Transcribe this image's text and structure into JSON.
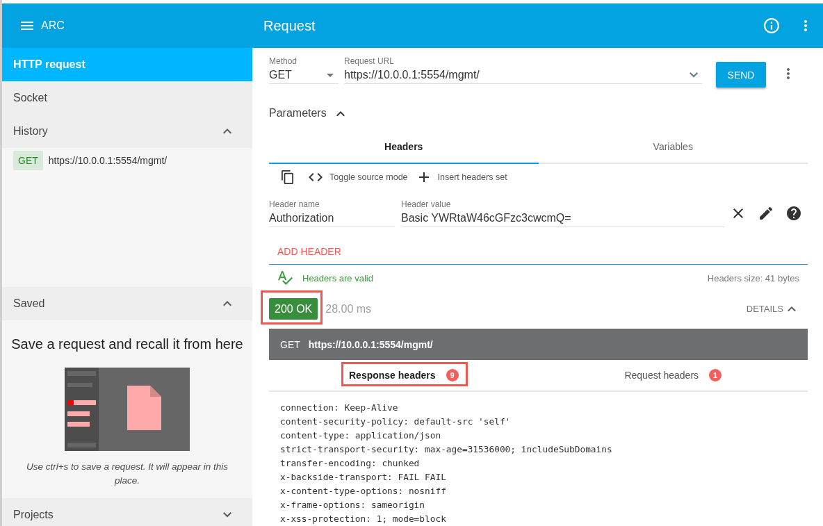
{
  "app_bar": {
    "title": "ARC"
  },
  "sidebar": {
    "items": [
      {
        "label": "HTTP request",
        "selected": true
      },
      {
        "label": "Socket",
        "selected": false
      }
    ],
    "history": {
      "title": "History",
      "expanded": true,
      "entries": [
        {
          "method": "GET",
          "url": "https://10.0.0.1:5554/mgmt/"
        }
      ]
    },
    "saved": {
      "title": "Saved",
      "expanded": true,
      "empty_title": "Save a request and recall it from here",
      "empty_hint": "Use ctrl+s to save a request. It will appear in this place."
    },
    "projects": {
      "title": "Projects",
      "expanded": false
    }
  },
  "toolbar": {
    "title": "Request"
  },
  "request": {
    "method": {
      "label": "Method",
      "value": "GET"
    },
    "url": {
      "label": "Request URL",
      "value": "https://10.0.0.1:5554/mgmt/"
    },
    "send_button": "SEND"
  },
  "parameters": {
    "label": "Parameters",
    "expanded": true,
    "tabs": [
      {
        "label": "Headers",
        "selected": true
      },
      {
        "label": "Variables",
        "selected": false
      }
    ],
    "actions": [
      {
        "kind": "copy"
      },
      {
        "kind": "source",
        "label": "Toggle source mode"
      },
      {
        "kind": "insert",
        "label": "Insert headers set"
      }
    ],
    "headers": [
      {
        "name_label": "Header name",
        "name": "Authorization",
        "value_label": "Header value",
        "value": "Basic YWRtaW46cGFzc3cwcmQ="
      }
    ],
    "add_button": "ADD HEADER",
    "validation": {
      "valid": true,
      "message": "Headers are valid"
    },
    "size": "Headers size: 41 bytes"
  },
  "response": {
    "status": {
      "text": "200 OK",
      "kind": "success",
      "highlighted": true
    },
    "time": "28.00 ms",
    "details_button": "DETAILS",
    "details_expanded": true,
    "request_line": {
      "method": "GET",
      "url": "https://10.0.0.1:5554/mgmt/"
    },
    "tabs": [
      {
        "label": "Response headers",
        "count": "9",
        "selected": true,
        "highlighted": true
      },
      {
        "label": "Request headers",
        "count": "1",
        "selected": false,
        "highlighted": false
      }
    ],
    "headers": [
      "connection: Keep-Alive",
      "content-security-policy: default-src 'self'",
      "content-type: application/json",
      "strict-transport-security: max-age=31536000; includeSubDomains",
      "transfer-encoding: chunked",
      "x-backside-transport: FAIL FAIL",
      "x-content-type-options: nosniff",
      "x-frame-options: sameorigin",
      "x-xss-protection: 1; mode=block"
    ]
  }
}
